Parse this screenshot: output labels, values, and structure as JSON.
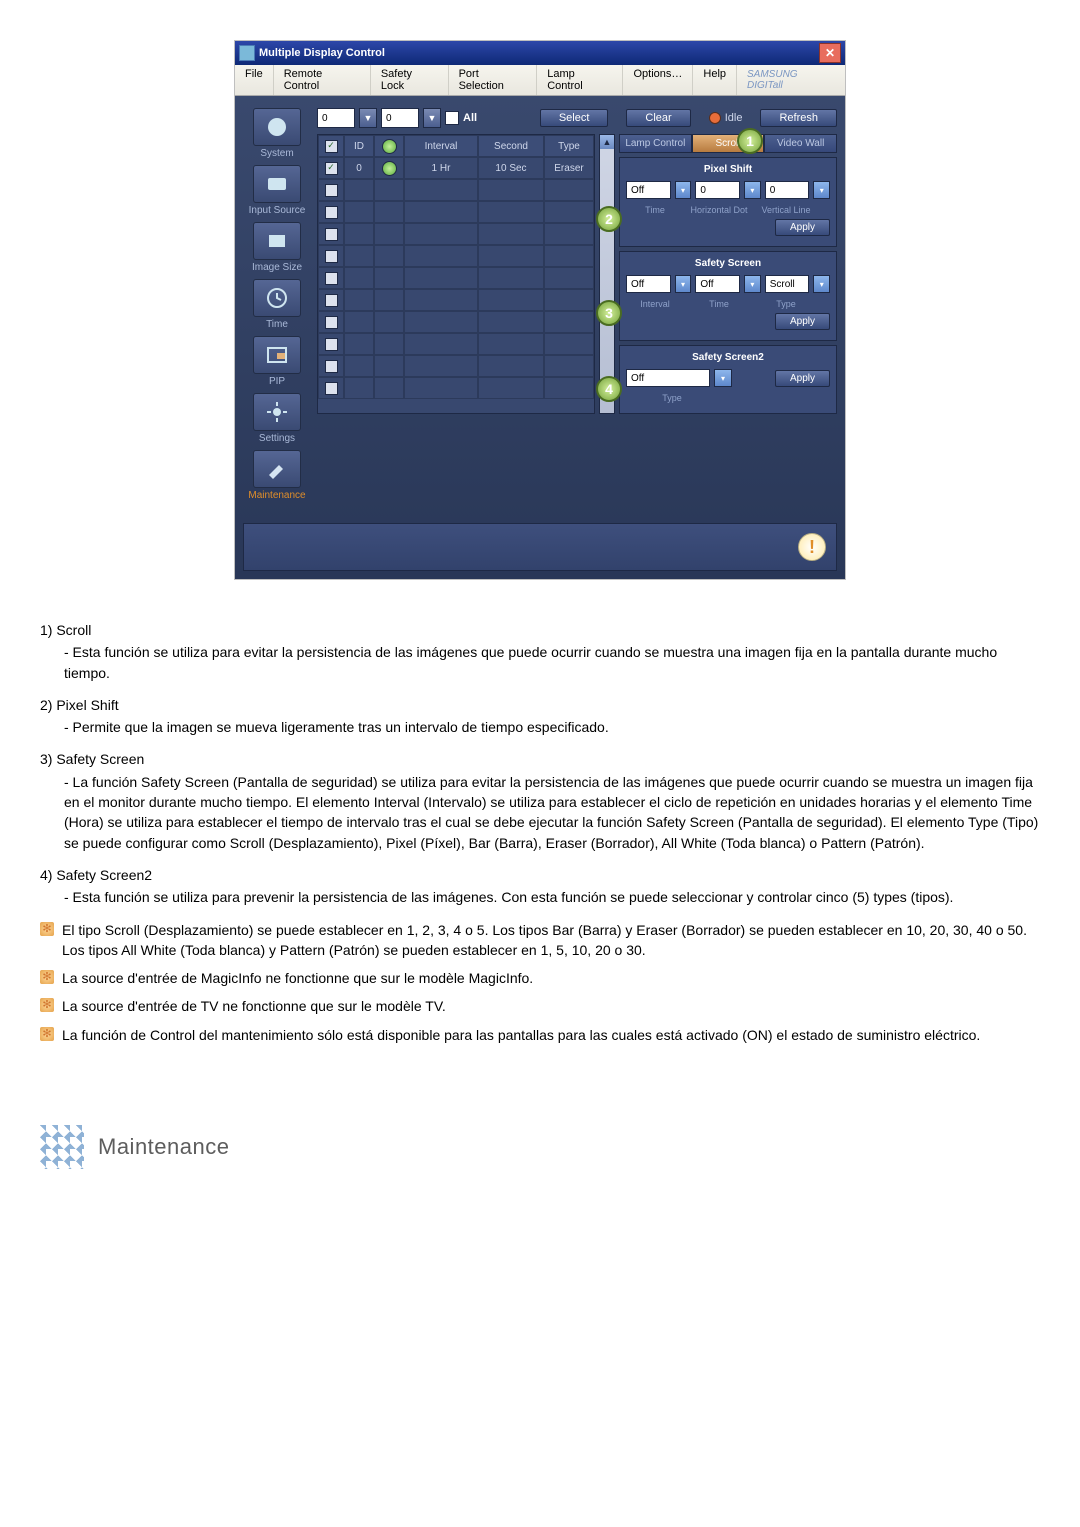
{
  "win_title": "Multiple Display Control",
  "menus": [
    "File",
    "Remote Control",
    "Safety Lock",
    "Port Selection",
    "Lamp Control",
    "Options…",
    "Help"
  ],
  "brand": "SAMSUNG DIGITall",
  "sidebar": [
    {
      "label": "System"
    },
    {
      "label": "Input Source"
    },
    {
      "label": "Image Size"
    },
    {
      "label": "Time"
    },
    {
      "label": "PIP"
    },
    {
      "label": "Settings"
    },
    {
      "label": "Maintenance",
      "active": true
    }
  ],
  "top": {
    "field1": "0",
    "field2": "0",
    "all": "All",
    "select": "Select",
    "clear": "Clear",
    "idle": "Idle",
    "refresh": "Refresh"
  },
  "grid_head": [
    "",
    "ID",
    "",
    "Interval",
    "Second",
    "Type"
  ],
  "grid_rows": [
    {
      "checked": true,
      "id": "0",
      "green": true,
      "interval": "1 Hr",
      "second": "10 Sec",
      "type": "Eraser"
    },
    {
      "checked": false
    },
    {
      "checked": false
    },
    {
      "checked": false
    },
    {
      "checked": false
    },
    {
      "checked": false
    },
    {
      "checked": false
    },
    {
      "checked": false
    },
    {
      "checked": false
    },
    {
      "checked": false
    },
    {
      "checked": false
    }
  ],
  "tabs": [
    "Lamp Control",
    "Scroll",
    "Video Wall"
  ],
  "pixel_shift": {
    "title": "Pixel Shift",
    "v1": "Off",
    "v2": "0",
    "v3": "0",
    "l1": "Time",
    "l2": "Horizontal Dot",
    "l3": "Vertical Line",
    "apply": "Apply"
  },
  "safety_screen": {
    "title": "Safety Screen",
    "v1": "Off",
    "v2": "Off",
    "v3": "Scroll",
    "l1": "Interval",
    "l2": "Time",
    "l3": "Type",
    "apply": "Apply"
  },
  "safety_screen2": {
    "title": "Safety Screen2",
    "v1": "Off",
    "l1": "Type",
    "apply": "Apply"
  },
  "callouts": [
    "1",
    "2",
    "3",
    "4"
  ],
  "doc": {
    "items": [
      {
        "n": "1)",
        "t": "Scroll",
        "d": "- Esta función se utiliza para evitar la persistencia de las imágenes que puede ocurrir cuando se muestra una imagen fija en la pantalla durante mucho tiempo."
      },
      {
        "n": "2)",
        "t": "Pixel Shift",
        "d": "- Permite que la imagen se mueva ligeramente tras un intervalo de tiempo especificado."
      },
      {
        "n": "3)",
        "t": "Safety Screen",
        "d": "- La función Safety Screen (Pantalla de seguridad) se utiliza para evitar la persistencia de las imágenes que puede ocurrir cuando se muestra un imagen fija en el monitor durante mucho tiempo. El elemento Interval (Intervalo) se utiliza para establecer el ciclo de repetición en unidades horarias y el elemento Time (Hora) se utiliza para establecer el tiempo de intervalo tras el cual se debe ejecutar la función Safety Screen (Pantalla de seguridad). El elemento Type (Tipo) se puede configurar como Scroll (Desplazamiento), Pixel (Píxel), Bar (Barra), Eraser (Borrador), All White (Toda blanca) o Pattern (Patrón)."
      },
      {
        "n": "4)",
        "t": "Safety Screen2",
        "d": "- Esta función se utiliza para prevenir la persistencia de las imágenes. Con esta función se puede seleccionar y controlar cinco (5) types (tipos)."
      }
    ],
    "notes": [
      "El tipo Scroll (Desplazamiento) se puede establecer en 1, 2, 3, 4 o 5. Los tipos Bar (Barra) y Eraser (Borrador) se pueden establecer en 10, 20, 30, 40 o 50. Los tipos All White (Toda blanca) y Pattern (Patrón) se pueden establecer en 1, 5, 10, 20 o 30.",
      "La source d'entrée de MagicInfo ne fonctionne que sur le modèle MagicInfo.",
      "La source d'entrée de TV ne fonctionne que sur le modèle TV.",
      "La función de Control del mantenimiento sólo está disponible para las pantallas para las cuales está activado (ON) el estado de suministro eléctrico."
    ]
  },
  "section_heading": "Maintenance"
}
